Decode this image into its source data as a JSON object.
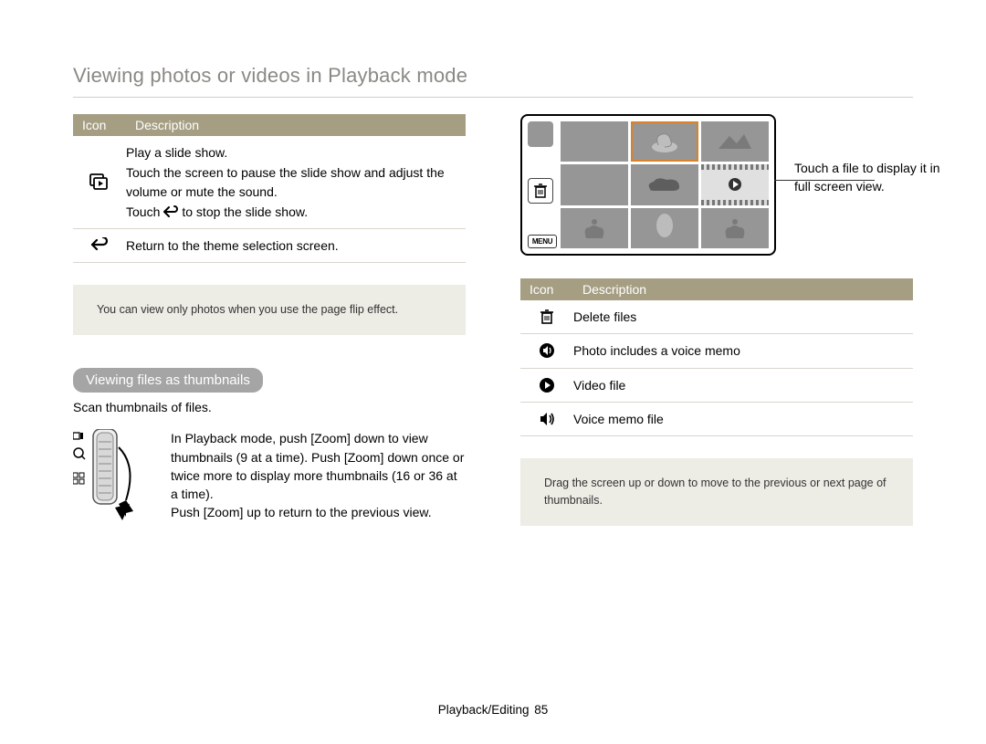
{
  "page_title": "Viewing photos or videos in Playback mode",
  "left": {
    "table_header": {
      "icon": "Icon",
      "desc": "Description"
    },
    "rows": [
      {
        "icon_name": "slideshow-icon",
        "lines": [
          "Play a slide show.",
          "Touch the screen to pause the slide show and adjust the volume or mute the sound."
        ],
        "touch_prefix": "Touch",
        "touch_suffix": " to stop the slide show."
      },
      {
        "icon_name": "back-icon",
        "lines": [
          "Return to the theme selection screen."
        ]
      }
    ],
    "note": "You can view only photos when you use the page ﬂip effect.",
    "loz": "Viewing ﬁles as thumbnails",
    "subtext": "Scan thumbnails of ﬁles.",
    "zoom_text": "In Playback mode, push [Zoom] down to view thumbnails (9 at a time). Push [Zoom] down once or twice more to display more thumbnails (16 or 36 at a time).",
    "zoom_text2": "Push [Zoom] up to return to the previous view."
  },
  "right": {
    "side_menu_label": "MENU",
    "callout": "Touch a ﬁle to display it in full screen view.",
    "table_header": {
      "icon": "Icon",
      "desc": "Description"
    },
    "rows": [
      {
        "icon_name": "trash-icon",
        "text": "Delete ﬁles"
      },
      {
        "icon_name": "voice-photo-icon",
        "text": "Photo includes a voice memo"
      },
      {
        "icon_name": "video-file-icon",
        "text": "Video ﬁle"
      },
      {
        "icon_name": "voice-memo-icon",
        "text": "Voice memo ﬁle"
      }
    ],
    "note": "Drag the screen up or down to move to the previous or next page of thumbnails."
  },
  "footer": {
    "section": "Playback/Editing",
    "page": "85"
  }
}
